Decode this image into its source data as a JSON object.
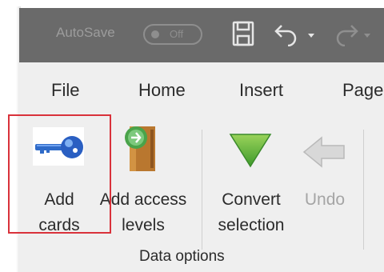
{
  "titlebar": {
    "autosave_label": "AutoSave",
    "autosave_state": "Off",
    "icons": [
      "save-icon",
      "undo-icon",
      "redo-icon"
    ]
  },
  "menu": {
    "tabs": [
      {
        "label": "File"
      },
      {
        "label": "Home"
      },
      {
        "label": "Insert"
      },
      {
        "label": "Page"
      }
    ]
  },
  "ribbon": {
    "buttons": [
      {
        "line1": "Add",
        "line2": "cards",
        "icon": "key-icon",
        "enabled": true
      },
      {
        "line1": "Add access",
        "line2": "levels",
        "icon": "door-icon",
        "enabled": true
      },
      {
        "line1": "Convert",
        "line2": "selection",
        "icon": "down-arrow-icon",
        "enabled": true
      },
      {
        "line1": "Undo",
        "line2": "",
        "icon": "left-arrow-icon",
        "enabled": false
      }
    ],
    "group_label": "Data options"
  },
  "colors": {
    "titlebar": "#6a6a6a",
    "ribbon": "#efefef",
    "highlight": "#d9323b"
  }
}
